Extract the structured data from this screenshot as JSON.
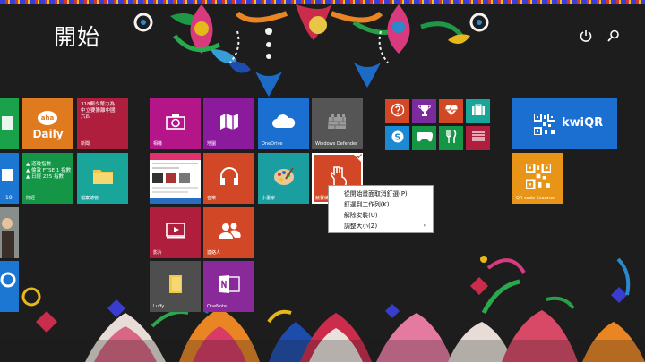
{
  "screen": {
    "title": "開始"
  },
  "top": {
    "power_icon": "power-icon",
    "search_icon": "search-icon"
  },
  "colors": {
    "accent": "#d24726",
    "menu_bg": "#ffffff"
  },
  "tiles": {
    "aha_brand": "aha",
    "aha_label": "Daily",
    "news": {
      "line1": "318郵夕幣力為",
      "line2": "中立要籌離中國",
      "line3": "六四",
      "caption": "新聞"
    },
    "finance": {
      "line1": "▲ 道瓊指數",
      "line2": "▲ 倫敦 FTSE 1 指數",
      "line3": "▲ 日經 225 指數",
      "caption": "財經"
    },
    "calendar_day": "19",
    "file_manager": "檔案總管",
    "camera": "相機",
    "maps": "地圖",
    "onedrive": "OneDrive",
    "defender": "Windows Defender",
    "music": "音樂",
    "paint": "小畫家",
    "selected_app": "競賽練習",
    "video": "影片",
    "people": "連絡人",
    "luffy": "Luffy",
    "onenote": "OneNote",
    "kwiqr": "kwiQR",
    "qr_scanner": "QR code Scanner"
  },
  "context_menu": {
    "items": [
      {
        "label": "從開始畫面取消釘選(P)"
      },
      {
        "label": "釘選到工作列(K)"
      },
      {
        "label": "解除安裝(U)"
      },
      {
        "label": "調整大小(Z)",
        "arrow": "›"
      }
    ]
  }
}
